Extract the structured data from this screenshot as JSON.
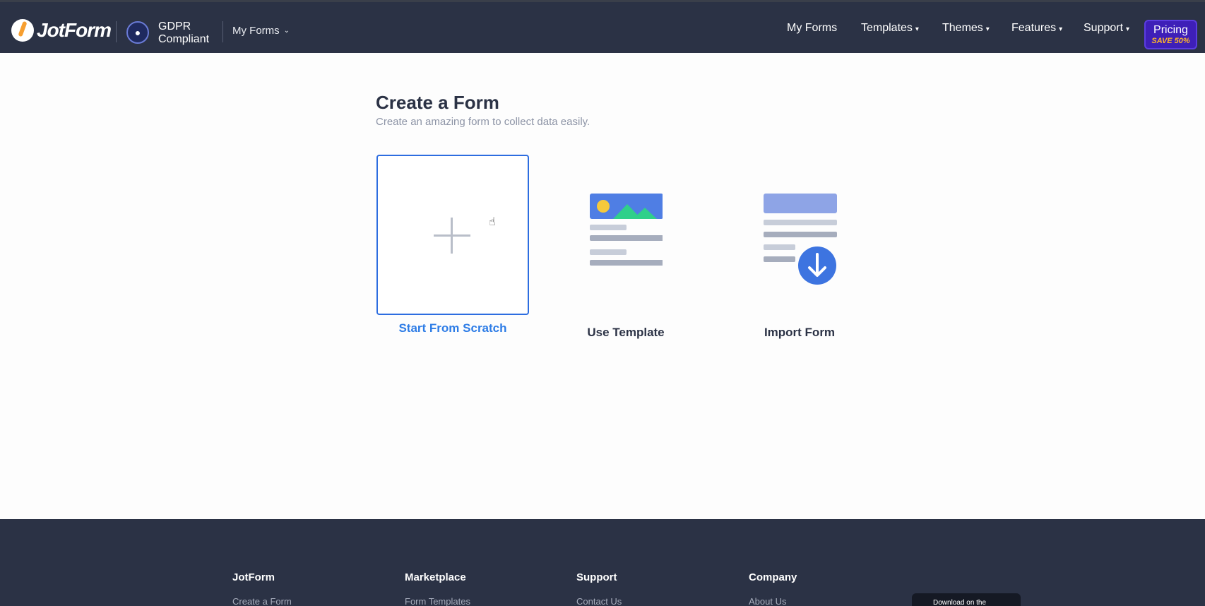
{
  "nav": {
    "brand": "JotForm",
    "gdpr_line1": "GDPR",
    "gdpr_line2": "Compliant",
    "myforms_dropdown": "My Forms",
    "items": [
      {
        "label": "My Forms"
      },
      {
        "label": "Templates"
      },
      {
        "label": "Themes"
      },
      {
        "label": "Features"
      },
      {
        "label": "Support"
      }
    ],
    "pricing_label": "Pricing",
    "pricing_badge": "SAVE 50%"
  },
  "main": {
    "title": "Create a Form",
    "subtitle": "Create an amazing form to collect data easily.",
    "options": [
      {
        "label": "Start From Scratch"
      },
      {
        "label": "Use Template"
      },
      {
        "label": "Import Form"
      }
    ]
  },
  "footer": {
    "columns": [
      {
        "heading": "JotForm",
        "first_link": "Create a Form"
      },
      {
        "heading": "Marketplace",
        "first_link": "Form Templates"
      },
      {
        "heading": "Support",
        "first_link": "Contact Us"
      },
      {
        "heading": "Company",
        "first_link": "About Us"
      }
    ],
    "appstore_label": "Download on the"
  },
  "colors": {
    "navbar": "#2b3245",
    "accent": "#2d6de0",
    "pricing_bg": "#3e1fb8",
    "pricing_badge": "#ffb629"
  },
  "icons": [
    "jotform-logo-icon",
    "gdpr-lock-icon",
    "chevron-down-icon",
    "plus-icon",
    "template-icon",
    "import-icon",
    "download-arrow-icon",
    "apple-icon"
  ]
}
